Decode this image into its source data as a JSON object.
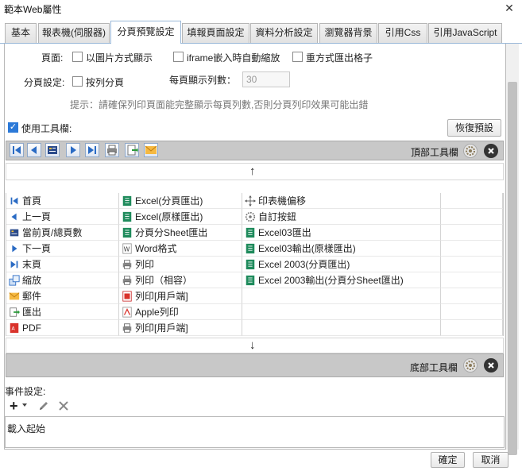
{
  "window": {
    "title": "範本Web屬性",
    "close_glyph": "✕"
  },
  "tabs": [
    {
      "label": "基本",
      "active": false
    },
    {
      "label": "報表機(伺服器)",
      "active": false
    },
    {
      "label": "分頁預覽設定",
      "active": true
    },
    {
      "label": "填報頁面設定",
      "active": false
    },
    {
      "label": "資料分析設定",
      "active": false
    },
    {
      "label": "瀏覽器背景",
      "active": false
    },
    {
      "label": "引用Css",
      "active": false
    },
    {
      "label": "引用JavaScript",
      "active": false
    }
  ],
  "page_settings": {
    "label": "頁面:",
    "opt_image": "以圖片方式顯示",
    "opt_iframe": "iframe嵌入時自動縮放",
    "opt_repeat": "重方式匯出格子"
  },
  "paging": {
    "label": "分頁設定:",
    "opt_by_column": "按列分頁",
    "rows_label": "每頁顯示列數：",
    "rows_value": "30",
    "hint": "提示：請確保列印頁面能完整顯示每頁列數,否則分頁列印效果可能出錯"
  },
  "toolbar": {
    "use_label": "使用工具欄:",
    "use_checked": true,
    "reset_label": "恢復預設",
    "top_label": "頂部工具欄",
    "bottom_label": "底部工具欄",
    "up_arrow": "↑",
    "down_arrow": "↓"
  },
  "buttons_grid": {
    "col1": [
      "首頁",
      "上一頁",
      "當前頁/總頁數",
      "下一頁",
      "末頁",
      "縮放",
      "郵件",
      "匯出",
      "PDF"
    ],
    "col2": [
      "Excel(分頁匯出)",
      "Excel(原樣匯出)",
      "分頁分Sheet匯出",
      "Word格式",
      "列印",
      "列印（相容）",
      "列印[用戶端]",
      "Apple列印",
      "列印[用戶端]"
    ],
    "col3": [
      "印表機偏移",
      "自訂按鈕",
      "Excel03匯出",
      "Excel03輸出(原樣匯出)",
      "Excel 2003(分頁匯出)",
      "Excel 2003輸出(分頁分Sheet匯出)",
      "",
      "",
      ""
    ]
  },
  "events": {
    "label": "事件設定:",
    "add_glyph": "+",
    "item": "載入起始"
  },
  "footer": {
    "ok_label": "確定",
    "cancel_label": "取消"
  },
  "colors": {
    "accent": "#2b79d8",
    "tab_border": "#9ab8d8",
    "toolbar_bg": "#c8c8c8"
  }
}
